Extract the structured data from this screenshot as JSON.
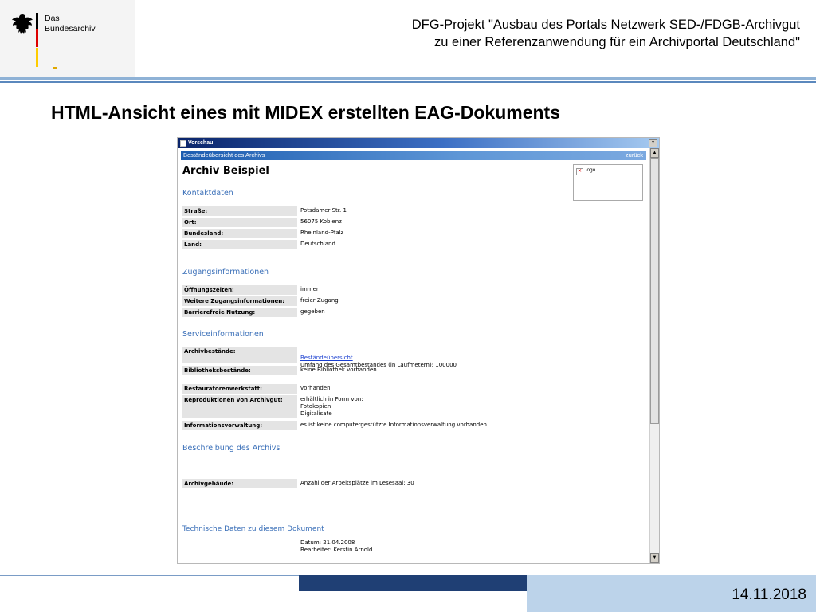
{
  "logo": {
    "line1": "Das",
    "line2": "Bundesarchiv"
  },
  "header": {
    "line1": "DFG-Projekt \"Ausbau des Portals Netzwerk SED-/FDGB-Archivgut",
    "line2": "zu einer Referenzanwendung für ein Archivportal Deutschland\""
  },
  "page_title": "HTML-Ansicht eines mit MIDEX erstellten EAG-Dokuments",
  "preview": {
    "window_title": "Vorschau",
    "nav_title": "Beständeübersicht des Archivs",
    "nav_back": "zurück",
    "archive_name": "Archiv Beispiel",
    "logo_alt": "logo",
    "sections": {
      "kontakt": "Kontaktdaten",
      "zugang": "Zugangsinformationen",
      "service": "Serviceinformationen",
      "beschreibung": "Beschreibung des Archivs"
    },
    "kontakt_rows": [
      {
        "label": "Straße:",
        "value": "Potsdamer Str. 1"
      },
      {
        "label": "Ort:",
        "value": "56075 Koblenz"
      },
      {
        "label": "Bundesland:",
        "value": "Rheinland-Pfalz"
      },
      {
        "label": "Land:",
        "value": "Deutschland"
      }
    ],
    "zugang_rows": [
      {
        "label": "Öffnungszeiten:",
        "value": "immer"
      },
      {
        "label": "Weitere Zugangsinformationen:",
        "value": "freier Zugang"
      },
      {
        "label": "Barrierefreie Nutzung:",
        "value": "gegeben"
      }
    ],
    "service_rows": {
      "bestaende_label": "Archivbestände:",
      "bestaende_link": "Beständeübersicht",
      "bestaende_value": "Umfang des Gesamtbestandes (in Laufmetern): 100000",
      "bibliothek_label": "Bibliotheksbestände:",
      "bibliothek_value": "keine Bibliothek vorhanden",
      "restaurator_label": "Restauratorenwerkstatt:",
      "restaurator_value": "vorhanden",
      "repro_label": "Reproduktionen von Archivgut:",
      "repro_value": "erhältlich in Form von:\nFotokopien\nDigitalisate",
      "info_label": "Informationsverwaltung:",
      "info_value": "es ist keine computergestützte Informationsverwaltung vorhanden"
    },
    "beschreibung_rows": [
      {
        "label": "Archivgebäude:",
        "value": "Anzahl der Arbeitsplätze im Lesesaal: 30"
      }
    ],
    "tech_heading": "Technische Daten zu diesem Dokument",
    "tech_date": "Datum: 21.04.2008",
    "tech_editor": "Bearbeiter: Kerstin Arnold"
  },
  "footer": {
    "date": "14.11.2018"
  },
  "colors": {
    "accent_blue": "#3a6fb8",
    "band_blue": "#8fb2d6",
    "footer_dark": "#1f3f74",
    "footer_light": "#bcd3ea"
  }
}
